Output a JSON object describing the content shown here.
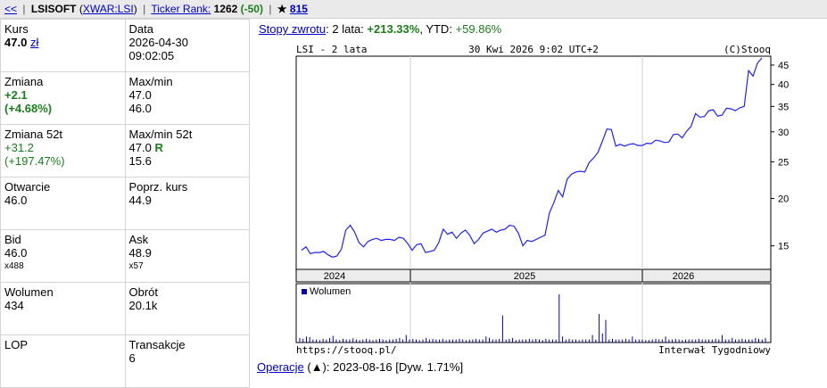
{
  "header": {
    "back": "<<",
    "ticker": "LSISOFT",
    "exchange": "XWAR:LSI",
    "ticker_rank_label": "Ticker Rank:",
    "rank": "1262",
    "rank_change": "(-50)",
    "star": "★",
    "star_count": "815"
  },
  "stats": [
    [
      {
        "label": "Kurs",
        "value": "47.0",
        "unit": "zł"
      },
      {
        "label": "Data",
        "lines": [
          "2026-04-30",
          "09:02:05"
        ]
      }
    ],
    [
      {
        "label": "Zmiana",
        "lines": [
          "+2.1",
          "(+4.68%)"
        ]
      },
      {
        "label": "Max/min",
        "lines": [
          "47.0",
          "46.0"
        ]
      }
    ],
    [
      {
        "label": "Zmiana 52t",
        "lines": [
          "+31.2",
          "(+197.47%)"
        ]
      },
      {
        "label": "Max/min 52t",
        "lines": [
          "47.0",
          "15.6"
        ],
        "flag": "R"
      }
    ],
    [
      {
        "label": "Otwarcie",
        "lines": [
          "46.0"
        ]
      },
      {
        "label": "Poprz. kurs",
        "lines": [
          "44.9"
        ]
      }
    ],
    [
      {
        "label": "Bid",
        "lines": [
          "46.0"
        ],
        "sub": "x488"
      },
      {
        "label": "Ask",
        "lines": [
          "48.9"
        ],
        "sub": "x57"
      }
    ],
    [
      {
        "label": "Wolumen",
        "lines": [
          "434"
        ]
      },
      {
        "label": "Obrót",
        "lines": [
          "20.1k"
        ]
      }
    ],
    [
      {
        "label": "LOP",
        "lines": []
      },
      {
        "label": "Transakcje",
        "lines": [
          "6"
        ]
      }
    ]
  ],
  "returns": {
    "link": "Stopy zwrotu",
    "text1": ": 2 lata: ",
    "v2y": "+213.33%",
    "text2": ", YTD: ",
    "vytd": "+59.86%"
  },
  "chart_header": {
    "left": "LSI - 2 lata",
    "center": "30 Kwi 2026 9:02 UTC+2",
    "right": "(C)Stooq"
  },
  "footer": {
    "left": "https://stooq.pl/",
    "right": "Interwał Tygodniowy"
  },
  "operations": {
    "link": "Operacje",
    "text": " (▲): 2023-08-16 [Dyw. 1.71%]"
  },
  "volume_label": "Wolumen",
  "colors": {
    "line": "#2020ff",
    "volume": "#0000aa",
    "green": "#1a7f1a",
    "link": "#0000cc"
  },
  "chart_data": {
    "type": "line",
    "title": "LSI - 2 lata",
    "y_scale": "log",
    "ylim": [
      13,
      47.5
    ],
    "yticks": [
      15,
      20,
      25,
      30,
      35,
      40,
      45
    ],
    "x_labels": [
      "2024",
      "2025",
      "2026"
    ],
    "series": [
      {
        "values": [
          14.6,
          14.9,
          14.3,
          14.4,
          14.4,
          14.5,
          14.2,
          14.0,
          14.1,
          14.7,
          16.5,
          17.0,
          16.3,
          15.3,
          14.9,
          15.4,
          15.6,
          15.7,
          15.5,
          15.6,
          15.6,
          15.5,
          15.8,
          15.7,
          15.2,
          14.6,
          15.1,
          15.2,
          14.4,
          14.5,
          14.6,
          15.3,
          16.6,
          16.1,
          16.3,
          15.7,
          16.2,
          16.5,
          16.0,
          15.2,
          15.6,
          16.2,
          16.4,
          16.6,
          16.3,
          16.5,
          16.6,
          17.0,
          16.9,
          16.2,
          15.0,
          15.5,
          15.4,
          15.6,
          15.8,
          16.0,
          18.3,
          19.5,
          21.0,
          20.2,
          22.5,
          23.2,
          23.5,
          23.6,
          23.5,
          24.9,
          25.6,
          26.5,
          28.4,
          30.5,
          30.4,
          27.5,
          27.8,
          27.5,
          27.8,
          27.9,
          27.6,
          27.6,
          28.0,
          27.9,
          28.5,
          28.4,
          28.1,
          28.2,
          29.5,
          29.6,
          28.9,
          30.1,
          31.0,
          33.5,
          32.8,
          32.9,
          34.1,
          34.3,
          33.0,
          33.2,
          34.6,
          34.5,
          34.1,
          34.7,
          35.0,
          43.5,
          42.1,
          45.5,
          47.0
        ]
      }
    ],
    "volume_series": {
      "name": "Wolumen",
      "values": [
        0.15,
        0.12,
        0.2,
        0.18,
        0.1,
        0.1,
        0.08,
        0.12,
        0.1,
        0.15,
        0.22,
        0.1,
        0.08,
        0.12,
        0.1,
        0.1,
        0.14,
        0.1,
        0.08,
        0.1,
        0.12,
        0.1,
        0.08,
        0.1,
        0.12,
        0.1,
        0.08,
        0.1,
        0.1,
        0.12,
        0.15,
        0.1,
        0.25,
        0.1,
        0.12,
        0.1,
        0.08,
        0.1,
        0.15,
        0.1,
        0.12,
        0.1,
        0.1,
        0.12,
        0.08,
        0.1,
        0.1,
        0.1,
        0.12,
        0.1,
        0.08,
        0.1,
        0.1,
        0.12,
        0.1,
        0.1,
        0.2,
        0.15,
        0.1,
        0.1,
        0.12,
        0.9,
        0.1,
        0.12,
        0.15,
        0.08,
        0.1,
        0.1,
        0.1,
        0.12,
        0.1,
        0.12,
        0.1,
        0.08,
        0.12,
        0.1,
        0.1,
        0.1,
        1.6,
        0.2,
        0.1,
        0.12,
        0.1,
        0.1,
        0.08,
        0.1,
        0.1,
        0.1,
        0.25,
        0.1,
        0.95,
        0.3,
        0.75,
        0.1,
        0.12,
        0.1,
        0.1,
        0.1,
        0.12,
        0.1,
        0.2,
        0.1,
        0.1,
        0.1,
        0.08,
        0.08,
        0.1,
        0.12,
        0.1,
        0.1,
        0.2,
        0.1,
        0.1,
        0.12,
        0.1,
        0.08,
        0.1,
        0.1,
        0.1,
        0.1,
        0.12,
        0.1,
        0.1,
        0.1,
        0.1,
        0.12,
        0.1,
        0.25,
        0.1,
        0.1,
        0.15,
        0.1,
        0.1,
        0.12,
        0.1,
        0.1,
        0.1,
        0.15,
        0.12,
        0.1,
        0.15
      ]
    }
  }
}
